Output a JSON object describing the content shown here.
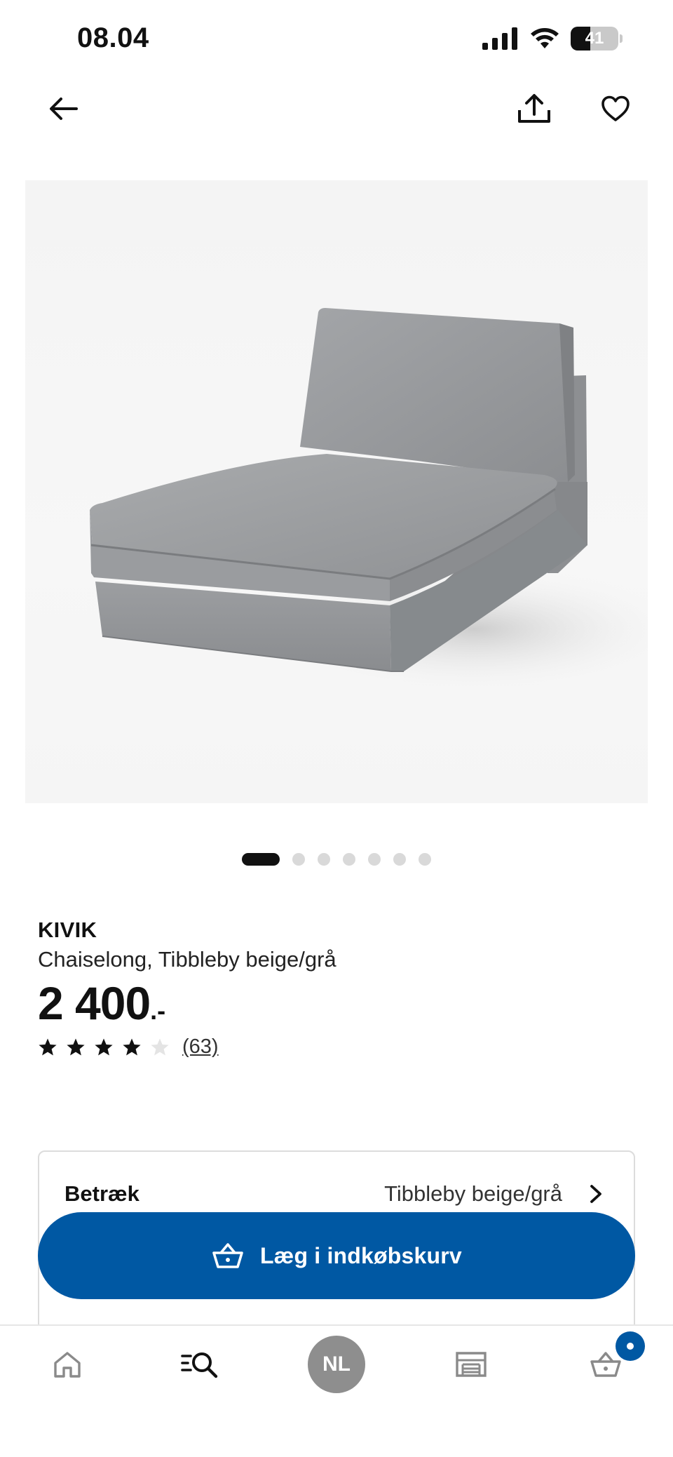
{
  "status_bar": {
    "time": "08.04",
    "battery": "41",
    "battery_level": 0.41
  },
  "nav": {
    "back_icon": "arrow-left-icon",
    "share_icon": "share-icon",
    "favorite_icon": "heart-icon"
  },
  "carousel": {
    "total": 7,
    "active_index": 0
  },
  "product": {
    "brand": "KIVIK",
    "description": "Chaiselong, Tibbleby beige/grå",
    "price": "2 400",
    "price_suffix": ".-",
    "rating": 4,
    "rating_max": 5,
    "review_count": "(63)"
  },
  "option": {
    "label": "Betræk",
    "value": "Tibbleby beige/grå"
  },
  "cart_button": {
    "label": "Læg i indkøbskurv",
    "icon": "basket-icon"
  },
  "bottom_nav": {
    "profile_initials": "NL",
    "items": [
      "home-icon",
      "search-icon",
      "avatar",
      "store-icon",
      "cart-icon"
    ]
  },
  "colors": {
    "brand_blue": "#0058a3",
    "text": "#111111",
    "avatar_gray": "#8e8e8e"
  }
}
